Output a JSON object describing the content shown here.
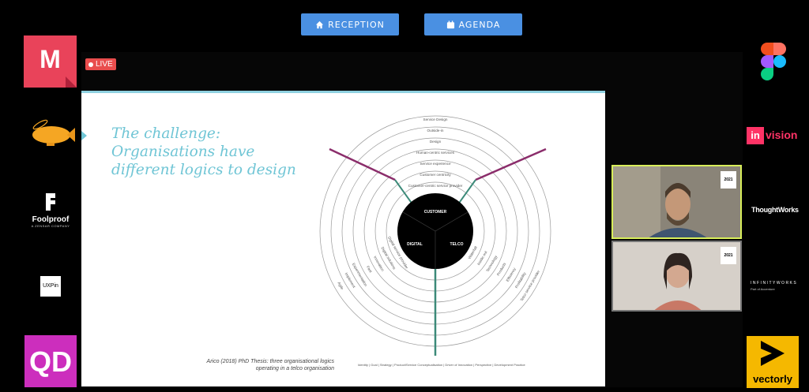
{
  "nav": {
    "reception_label": "RECEPTION",
    "agenda_label": "AGENDA"
  },
  "stream": {
    "live_label": "LIVE"
  },
  "slide": {
    "title_lines": [
      "The challenge:",
      "Organisations have",
      "different logics to design"
    ],
    "caption": "Arico (2018) PhD Thesis: three organisational logics operating in a telco organisation",
    "legend": "Identity | Goal | Strategy | Product/Service Conceptualisation | Driver of Innovation | Perspective | Development Practice",
    "diagram": {
      "center_labels": [
        "CUSTOMER",
        "DIGITAL",
        "TELCO"
      ],
      "customer_rings": [
        "Service Design",
        "Outside-in",
        "Design",
        "Human-centric services",
        "Service experience",
        "Customer centricity",
        "Customer-centric service provider"
      ],
      "digital_rings": [
        "Agile",
        "Implement",
        "Experimentation",
        "Fast",
        "Innovation",
        "Digital solutions",
        "Digital service provider"
      ],
      "telco_rings": [
        "Telco service provider",
        "Profitability",
        "Efficiency",
        "Products",
        "Technology",
        "Inside out",
        "Waterfall"
      ]
    }
  },
  "sponsors": {
    "miro": "M",
    "invision_in": "in",
    "invision_rest": "vision",
    "foolproof": "Foolproof",
    "foolproof_sub": "A ZENSAR COMPANY",
    "thoughtworks": "ThoughtWorks",
    "uxpin": "UXPin",
    "infinity": "INFINITYWORKS",
    "infinity_sub": "Part of Accenture",
    "qd": "QD",
    "vectorly": "vectorly"
  },
  "videos": {
    "badge": "2021"
  },
  "colors": {
    "accent_blue": "#4a90e2",
    "slide_title": "#6fc5d5",
    "customer_axis": "#8b2d6b",
    "telco_axis": "#3c8a79",
    "live_red": "#e94d4d"
  }
}
